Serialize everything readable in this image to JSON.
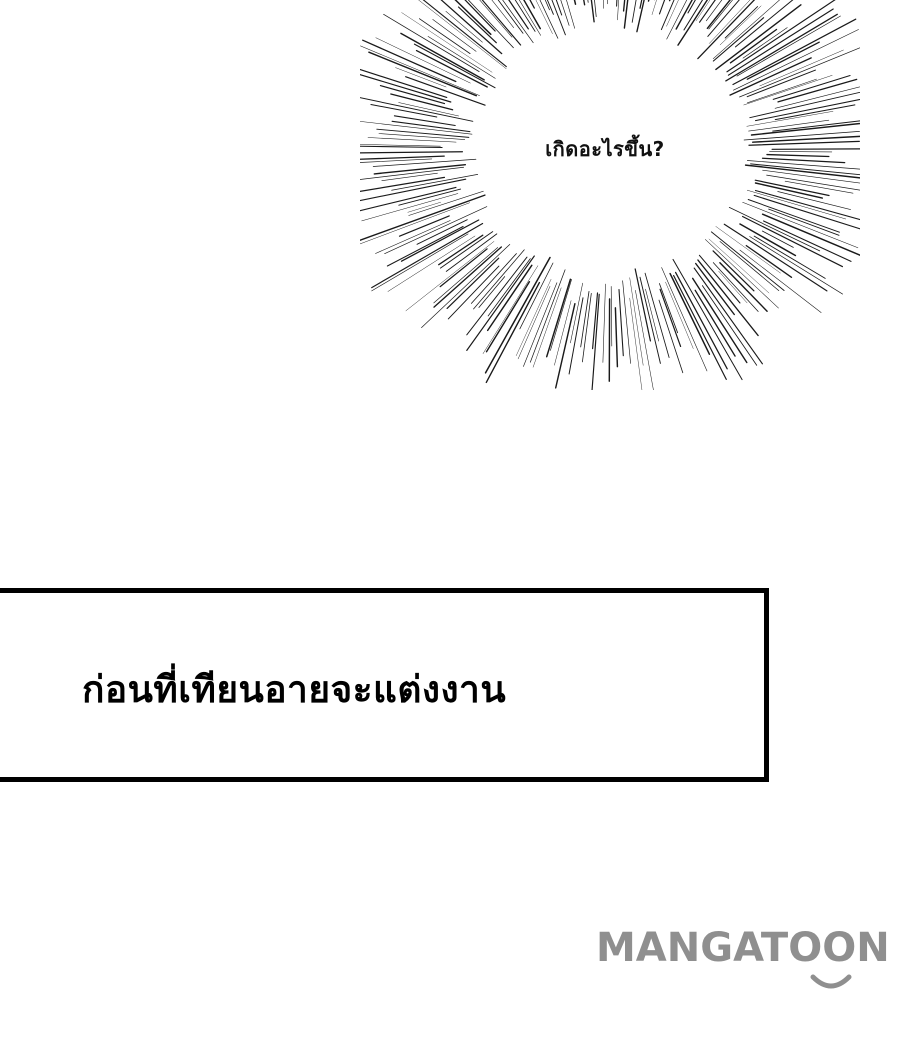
{
  "speech": {
    "text": "เกิดอะไรขึ้น?"
  },
  "caption": {
    "text": "ก่อนที่เทียนอายจะแต่งงาน"
  },
  "watermark": {
    "text": "MANGATOON",
    "color": "#8f8f8f"
  }
}
